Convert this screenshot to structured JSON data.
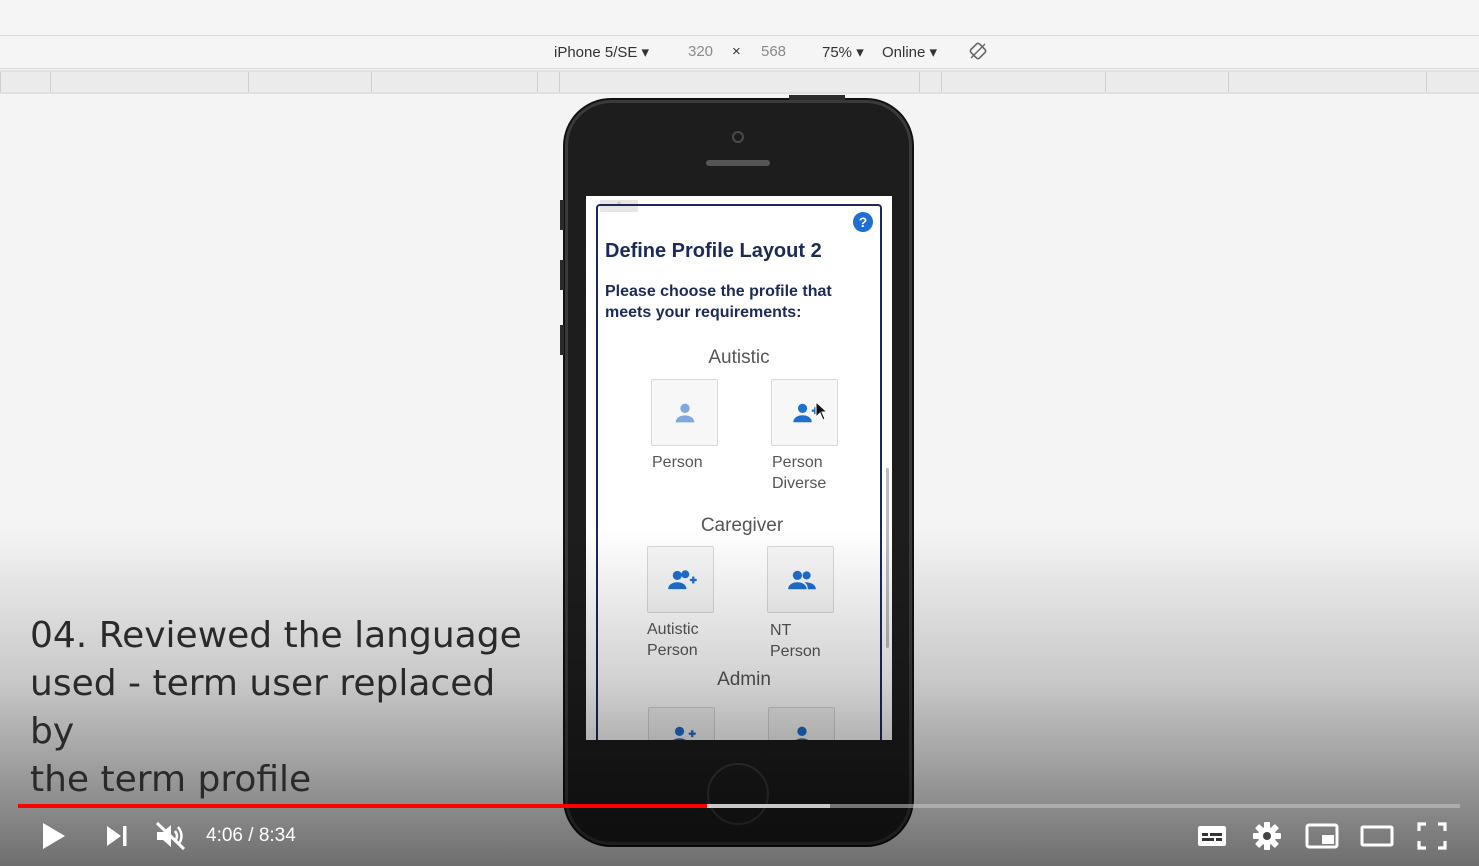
{
  "devtools": {
    "device": "iPhone 5/SE ▾",
    "width": "320",
    "times": "×",
    "height": "568",
    "zoom": "75% ▾",
    "network": "Online ▾"
  },
  "app": {
    "collapse_glyph": "^",
    "help_glyph": "?",
    "title": "Define Profile Layout 2",
    "subtitle": "Please choose the profile that meets your requirements:",
    "groups": [
      {
        "name": "Autistic",
        "tiles": [
          {
            "label_line1": "Person",
            "label_line2": "",
            "icon": "person-icon"
          },
          {
            "label_line1": "Person",
            "label_line2": "Diverse",
            "icon": "person-add-icon"
          }
        ]
      },
      {
        "name": "Caregiver",
        "tiles": [
          {
            "label_line1": "Autistic",
            "label_line2": "Person",
            "icon": "group-add-icon"
          },
          {
            "label_line1": "NT",
            "label_line2": "Person",
            "icon": "group-icon"
          }
        ]
      },
      {
        "name": "Admin",
        "tiles": [
          {
            "icon": "person-add-icon"
          },
          {
            "icon": "person-icon"
          }
        ]
      }
    ],
    "accent_color": "#1e6fd1",
    "title_color": "#1c2a5a"
  },
  "caption": {
    "line1": "04. Reviewed the language",
    "line2": "used - term user replaced by",
    "line3": "the term profile"
  },
  "player": {
    "current_time": "4:06",
    "separator": "/",
    "duration": "8:34",
    "played_fraction": 0.478,
    "buffered_fraction": 0.563,
    "progress_color": "#ff0000"
  }
}
